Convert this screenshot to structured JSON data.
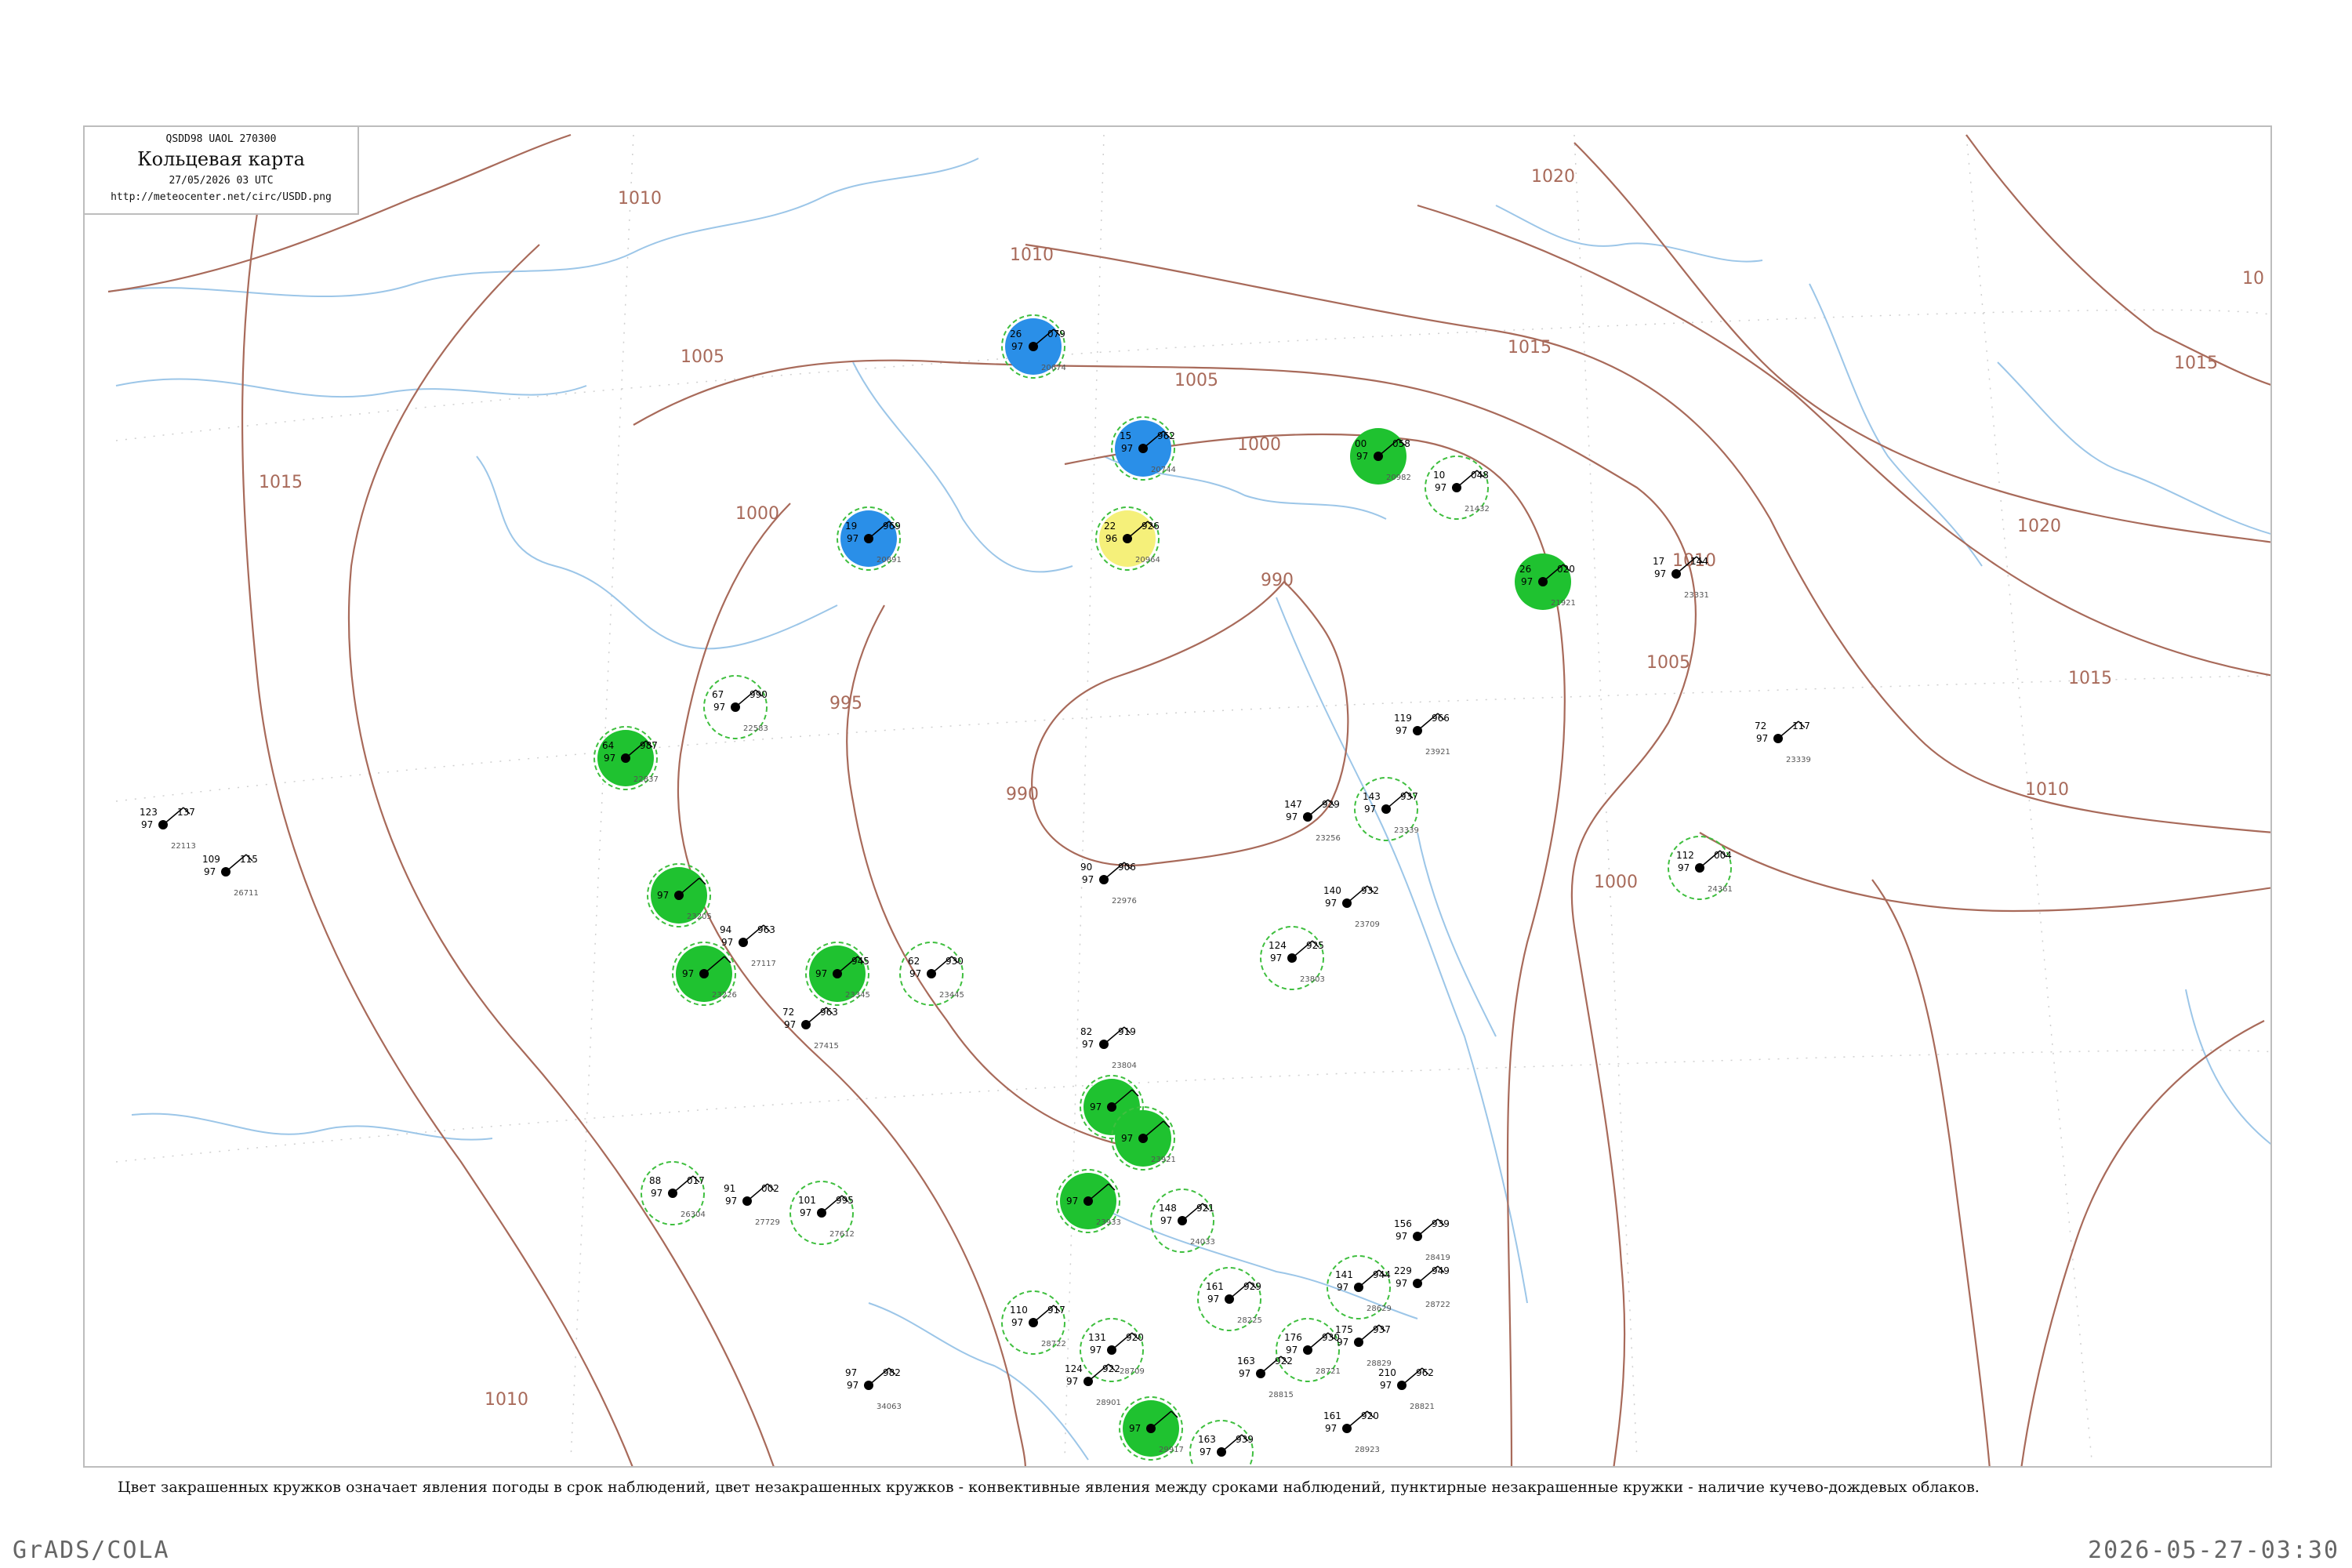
{
  "header": {
    "code": "QSDD98  UAOL  270300",
    "title": "Кольцевая карта",
    "date": "27/05/2026 03 UTC",
    "url": "http://meteocenter.net/circ/USDD.png"
  },
  "caption": "Цвет закрашенных кружков означает явления погоды в срок наблюдений, цвет незакрашенных кружков - конвективные явления между сроками наблюдений, пунктирные незакрашенные кружки - наличие кучево-дождевых облаков.",
  "footer": {
    "credit": "GrADS/COLA",
    "timestamp": "2026-05-27-03:30"
  },
  "colors": {
    "isobar": "#a86a5a",
    "river": "#9cc6e8",
    "grid": "#cfcfcf",
    "fill_rain": "#1fc230",
    "fill_snow": "#2a8fe8",
    "fill_fog": "#f5f07a",
    "ring_cb": "#3fbf3f"
  },
  "isobar_labels": [
    "1010",
    "1010",
    "1005",
    "1005",
    "1000",
    "1000",
    "995",
    "990",
    "990",
    "1015",
    "1015",
    "1020",
    "1020",
    "1010",
    "1005",
    "1000",
    "1015",
    "1015",
    "1010",
    "10",
    "1010"
  ],
  "stations": [
    {
      "fill": "snow",
      "ring": true,
      "top": "079",
      "left": "26",
      "p": "97",
      "id": "20674"
    },
    {
      "fill": "snow",
      "ring": true,
      "top": "962",
      "left": "15",
      "p": "97",
      "id": "20744"
    },
    {
      "fill": "snow",
      "ring": true,
      "top": "969",
      "left": "19",
      "p": "97",
      "id": "20891"
    },
    {
      "fill": "fog",
      "ring": true,
      "top": "926",
      "left": "22",
      "p": "96",
      "id": "20964"
    },
    {
      "fill": "rain",
      "ring": false,
      "top": "058",
      "left": "00",
      "p": "97",
      "id": "20982"
    },
    {
      "fill": "none",
      "ring": true,
      "top": "048",
      "left": "10",
      "p": "97",
      "id": "21432"
    },
    {
      "fill": "rain",
      "ring": false,
      "top": "020",
      "left": "26",
      "p": "97",
      "id": "21921"
    },
    {
      "fill": "none",
      "ring": true,
      "top": "990",
      "left": "67",
      "p": "97",
      "id": "22583"
    },
    {
      "fill": "rain",
      "ring": true,
      "top": "987",
      "left": "64",
      "p": "97",
      "id": "22837"
    },
    {
      "fill": "rain",
      "ring": true,
      "top": "",
      "left": "",
      "p": "97",
      "id": "23205"
    },
    {
      "fill": "rain",
      "ring": true,
      "top": "",
      "left": "",
      "p": "97",
      "id": "23226"
    },
    {
      "fill": "rain",
      "ring": true,
      "top": "945",
      "left": "",
      "p": "97",
      "id": "23345"
    },
    {
      "fill": "none",
      "ring": true,
      "top": "930",
      "left": "62",
      "p": "97",
      "id": "23445"
    },
    {
      "fill": "none",
      "ring": false,
      "top": "963",
      "left": "94",
      "p": "97",
      "id": "27117"
    },
    {
      "fill": "none",
      "ring": false,
      "top": "963",
      "left": "72",
      "p": "97",
      "id": "27415"
    },
    {
      "fill": "none",
      "ring": false,
      "top": "906",
      "left": "90",
      "p": "97",
      "id": "22976"
    },
    {
      "fill": "none",
      "ring": true,
      "top": "925",
      "left": "124",
      "p": "97",
      "id": "23803"
    },
    {
      "fill": "none",
      "ring": false,
      "top": "919",
      "left": "82",
      "p": "97",
      "id": "23804"
    },
    {
      "fill": "rain",
      "ring": true,
      "top": "",
      "left": "",
      "p": "97",
      "id": "23914"
    },
    {
      "fill": "rain",
      "ring": true,
      "top": "",
      "left": "",
      "p": "97",
      "id": "23921"
    },
    {
      "fill": "rain",
      "ring": true,
      "top": "",
      "left": "",
      "p": "97",
      "id": "23933"
    },
    {
      "fill": "none",
      "ring": true,
      "top": "017",
      "left": "88",
      "p": "97",
      "id": "26304"
    },
    {
      "fill": "none",
      "ring": false,
      "top": "002",
      "left": "91",
      "p": "97",
      "id": "27729"
    },
    {
      "fill": "none",
      "ring": true,
      "top": "995",
      "left": "101",
      "p": "97",
      "id": "27612"
    },
    {
      "fill": "none",
      "ring": true,
      "top": "921",
      "left": "148",
      "p": "97",
      "id": "24033"
    },
    {
      "fill": "none",
      "ring": false,
      "top": "939",
      "left": "156",
      "p": "97",
      "id": "28419"
    },
    {
      "fill": "none",
      "ring": true,
      "top": "929",
      "left": "161",
      "p": "97",
      "id": "28225"
    },
    {
      "fill": "none",
      "ring": true,
      "top": "917",
      "left": "110",
      "p": "97",
      "id": "28722"
    },
    {
      "fill": "none",
      "ring": true,
      "top": "920",
      "left": "131",
      "p": "97",
      "id": "28709"
    },
    {
      "fill": "none",
      "ring": false,
      "top": "922",
      "left": "124",
      "p": "97",
      "id": "28901"
    },
    {
      "fill": "none",
      "ring": false,
      "top": "922",
      "left": "163",
      "p": "97",
      "id": "28815"
    },
    {
      "fill": "none",
      "ring": true,
      "top": "930",
      "left": "176",
      "p": "97",
      "id": "28721"
    },
    {
      "fill": "rain",
      "ring": true,
      "top": "",
      "left": "",
      "p": "97",
      "id": "29917"
    },
    {
      "fill": "none",
      "ring": true,
      "top": "939",
      "left": "163",
      "p": "97",
      "id": "29915"
    },
    {
      "fill": "none",
      "ring": false,
      "top": "920",
      "left": "161",
      "p": "97",
      "id": "28923"
    },
    {
      "fill": "none",
      "ring": true,
      "top": "944",
      "left": "141",
      "p": "97",
      "id": "28629"
    },
    {
      "fill": "none",
      "ring": false,
      "top": "949",
      "left": "229",
      "p": "97",
      "id": "28722"
    },
    {
      "fill": "none",
      "ring": false,
      "top": "937",
      "left": "175",
      "p": "97",
      "id": "28829"
    },
    {
      "fill": "none",
      "ring": false,
      "top": "962",
      "left": "210",
      "p": "97",
      "id": "28821"
    },
    {
      "fill": "none",
      "ring": false,
      "top": "966",
      "left": "119",
      "p": "97",
      "id": "23921"
    },
    {
      "fill": "none",
      "ring": true,
      "top": "937",
      "left": "143",
      "p": "97",
      "id": "23339"
    },
    {
      "fill": "none",
      "ring": false,
      "top": "929",
      "left": "147",
      "p": "97",
      "id": "23256"
    },
    {
      "fill": "none",
      "ring": false,
      "top": "932",
      "left": "140",
      "p": "97",
      "id": "23709"
    },
    {
      "fill": "none",
      "ring": true,
      "top": "004",
      "left": "112",
      "p": "97",
      "id": "24361"
    },
    {
      "fill": "none",
      "ring": false,
      "top": "137",
      "left": "123",
      "p": "97",
      "id": "22113"
    },
    {
      "fill": "none",
      "ring": false,
      "top": "115",
      "left": "109",
      "p": "97",
      "id": "26711"
    },
    {
      "fill": "none",
      "ring": false,
      "top": "144",
      "left": "17",
      "p": "97",
      "id": "23331"
    },
    {
      "fill": "none",
      "ring": false,
      "top": "117",
      "left": "72",
      "p": "97",
      "id": "23339"
    },
    {
      "fill": "none",
      "ring": false,
      "top": "982",
      "left": "97",
      "p": "97",
      "id": "34063"
    }
  ]
}
